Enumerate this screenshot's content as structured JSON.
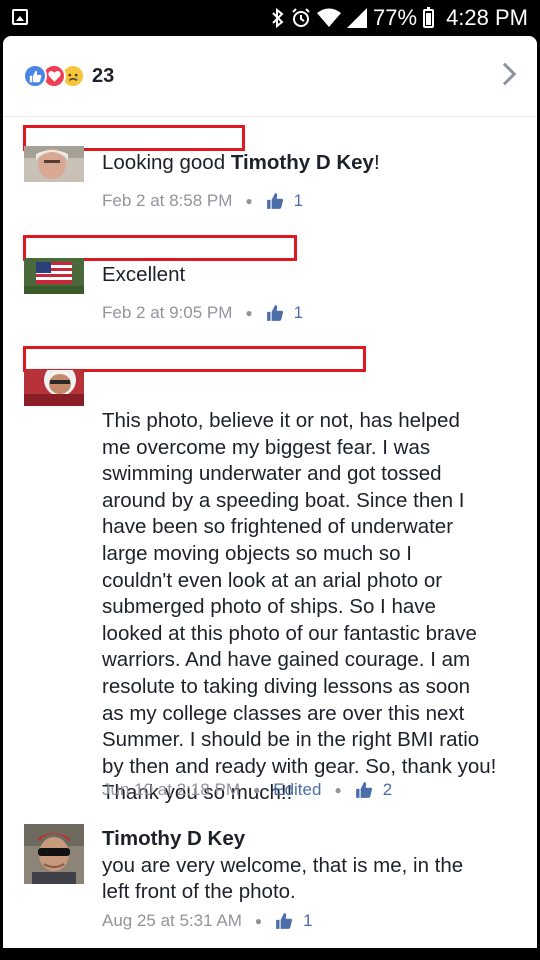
{
  "status_bar": {
    "battery": "77%",
    "time": "4:28 PM",
    "icons": [
      "gallery-icon",
      "bluetooth-icon",
      "alarm-icon",
      "wifi-icon",
      "signal-icon",
      "battery-icon"
    ]
  },
  "reactions": {
    "count": "23",
    "types": [
      "like",
      "love",
      "sad"
    ]
  },
  "comments": [
    {
      "author_redacted": true,
      "text_prefix": "Looking good ",
      "mention": "Timothy D Key",
      "text_suffix": "!",
      "timestamp": "Feb 2 at 8:58 PM",
      "likes": "1"
    },
    {
      "author_redacted": true,
      "text": "Excellent",
      "timestamp": "Feb 2 at 9:05 PM",
      "likes": "1"
    },
    {
      "author_redacted": true,
      "lines": [
        "This photo, believe it or not, has helped",
        "me overcome my biggest fear. I was",
        "swimming underwater and got tossed",
        "around by a speeding boat. Since then I",
        "have been so frightened of underwater",
        "large moving objects so much so I",
        "couldn't even look at an arial photo or",
        "submerged photo of ships. So I have",
        "looked at this photo of our fantastic brave",
        "warriors. And have gained courage. I am",
        "resolute to taking diving lessons as soon",
        "as my college classes are over this next",
        "Summer. I should be in the right BMI ratio",
        "by then and ready with gear. So, thank you!",
        "Thank you so much!!"
      ],
      "timestamp": "Jun 10 at 2:18 PM",
      "edited": "Edited",
      "likes": "2"
    },
    {
      "author": "Timothy D Key",
      "lines": [
        "you are very welcome, that is me, in the",
        "left front of the photo."
      ],
      "timestamp": "Aug 25 at 5:31 AM",
      "likes": "1"
    }
  ],
  "colors": {
    "accent": "#4b6ea9",
    "redaction": "#e0171f",
    "meta_text": "#90949c",
    "body_text": "#1d2129"
  }
}
